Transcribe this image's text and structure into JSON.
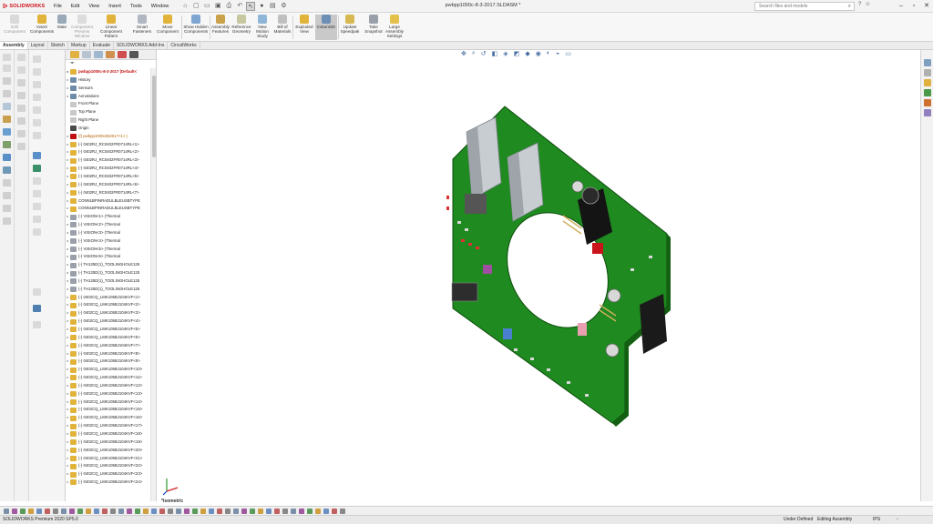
{
  "app": {
    "brand": "SOLIDWORKS",
    "menus": [
      "File",
      "Edit",
      "View",
      "Insert",
      "Tools",
      "Window"
    ],
    "document_title": "pwbpp1000c-8-3-2017.SLDASM *",
    "search_placeholder": "Search files and models"
  },
  "ribbon": {
    "buttons": [
      {
        "label": "Edit Component",
        "disabled": true
      },
      {
        "label": "Insert Components",
        "disabled": false
      },
      {
        "label": "Mate",
        "disabled": false
      },
      {
        "label": "Component Preview Window",
        "disabled": true
      },
      {
        "label": "Linear Component Pattern",
        "disabled": false
      },
      {
        "label": "Smart Fasteners",
        "disabled": false
      },
      {
        "label": "Move Component",
        "disabled": false
      },
      {
        "label": "Show Hidden Components",
        "disabled": false
      },
      {
        "label": "Assembly Features",
        "disabled": false
      },
      {
        "label": "Reference Geometry",
        "disabled": false
      },
      {
        "label": "New Motion Study",
        "disabled": false
      },
      {
        "label": "Bill of Materials",
        "disabled": false
      },
      {
        "label": "Exploded View",
        "disabled": false
      },
      {
        "label": "Instant3D",
        "disabled": false,
        "active": true
      },
      {
        "label": "Update Speedpak",
        "disabled": false
      },
      {
        "label": "Take Snapshot",
        "disabled": false
      },
      {
        "label": "Large Assembly Settings",
        "disabled": false
      }
    ]
  },
  "tabs": [
    "Assembly",
    "Layout",
    "Sketch",
    "Markup",
    "Evaluate",
    "SOLIDWORKS Add-Ins",
    "CircuitWorks"
  ],
  "tree": {
    "root": "pwbpp1000c-8-3-2017 (Default<",
    "items": [
      {
        "label": "History",
        "kind": "folder"
      },
      {
        "label": "Sensors",
        "kind": "folder"
      },
      {
        "label": "Annotations",
        "kind": "folder"
      },
      {
        "label": "Front Plane",
        "kind": "plane"
      },
      {
        "label": "Top Plane",
        "kind": "plane"
      },
      {
        "label": "Right Plane",
        "kind": "plane"
      },
      {
        "label": "Origin",
        "kind": "origin"
      },
      {
        "label": "(f) pwbpp1000c832017<1> (",
        "kind": "warn"
      },
      {
        "label": "(-) 0402RJ_RC0402FR0714RL<1>",
        "kind": "part"
      },
      {
        "label": "(-) 0402RJ_RC0402FR0714RL<2>",
        "kind": "part"
      },
      {
        "label": "(-) 0402RJ_RC0402FR0714RL<3>",
        "kind": "part"
      },
      {
        "label": "(-) 0402RJ_RC0402FR0714RL<4>",
        "kind": "part"
      },
      {
        "label": "(-) 0402RJ_RC0402FR0714RL<5>",
        "kind": "part"
      },
      {
        "label": "(-) 0402RJ_RC0402FR0714RL<6>",
        "kind": "part"
      },
      {
        "label": "(-) 0402RJ_RC0402FR0714RL<7>",
        "kind": "part"
      },
      {
        "label": "CONN1BPINRADULBLEUSBTYPE",
        "kind": "part"
      },
      {
        "label": "CONN1BPINRADULBLEUSBTYPE",
        "kind": "part"
      },
      {
        "label": "(-) VISION<1> (Thermal",
        "kind": "vision"
      },
      {
        "label": "(-) VISION<2> (Thermal",
        "kind": "vision"
      },
      {
        "label": "(-) VISION<3> (Thermal",
        "kind": "vision"
      },
      {
        "label": "(-) VISION<4> (Thermal",
        "kind": "vision"
      },
      {
        "label": "(-) VISION<5> (Thermal",
        "kind": "vision"
      },
      {
        "label": "(-) VISION<6> (Thermal",
        "kind": "vision"
      },
      {
        "label": "(-) TH125D(1)_TOOLINGHOLE125",
        "kind": "vision"
      },
      {
        "label": "(-) TH125D(1)_TOOLINGHOLE125",
        "kind": "vision"
      },
      {
        "label": "(-) TH125D(1)_TOOLINGHOLE125",
        "kind": "vision"
      },
      {
        "label": "(-) TH125D(1)_TOOLINGHOLE125",
        "kind": "vision"
      },
      {
        "label": "(-) 0402CQ_LMK105BJ104KVF<1>",
        "kind": "part"
      },
      {
        "label": "(-) 0402CQ_LMK105BJ104KVF<2>",
        "kind": "part"
      },
      {
        "label": "(-) 0402CQ_LMK105BJ104KVF<3>",
        "kind": "part"
      },
      {
        "label": "(-) 0402CQ_LMK105BJ104KVF<4>",
        "kind": "part"
      },
      {
        "label": "(-) 0402CQ_LMK105BJ104KVF<5>",
        "kind": "part"
      },
      {
        "label": "(-) 0402CQ_LMK105BJ104KVF<6>",
        "kind": "part"
      },
      {
        "label": "(-) 0402CQ_LMK105BJ104KVF<7>",
        "kind": "part"
      },
      {
        "label": "(-) 0402CQ_LMK105BJ104KVF<8>",
        "kind": "part"
      },
      {
        "label": "(-) 0402CQ_LMK105BJ104KVF<9>",
        "kind": "part"
      },
      {
        "label": "(-) 0402CQ_LMK105BJ104KVF<10>",
        "kind": "part"
      },
      {
        "label": "(-) 0402CQ_LMK105BJ104KVF<11>",
        "kind": "part"
      },
      {
        "label": "(-) 0402CQ_LMK105BJ104KVF<12>",
        "kind": "part"
      },
      {
        "label": "(-) 0402CQ_LMK105BJ104KVF<13>",
        "kind": "part"
      },
      {
        "label": "(-) 0402CQ_LMK105BJ104KVF<14>",
        "kind": "part"
      },
      {
        "label": "(-) 0402CQ_LMK105BJ104KVF<15>",
        "kind": "part"
      },
      {
        "label": "(-) 0402CQ_LMK105BJ104KVF<16>",
        "kind": "part"
      },
      {
        "label": "(-) 0402CQ_LMK105BJ104KVF<17>",
        "kind": "part"
      },
      {
        "label": "(-) 0402CQ_LMK105BJ104KVF<18>",
        "kind": "part"
      },
      {
        "label": "(-) 0402CQ_LMK105BJ104KVF<19>",
        "kind": "part"
      },
      {
        "label": "(-) 0402CQ_LMK105BJ104KVF<20>",
        "kind": "part"
      },
      {
        "label": "(-) 0402CQ_LMK105BJ104KVF<21>",
        "kind": "part"
      },
      {
        "label": "(-) 0402CQ_LMK105BJ104KVF<22>",
        "kind": "part"
      },
      {
        "label": "(-) 0402CQ_LMK105BJ104KVF<23>",
        "kind": "part"
      },
      {
        "label": "(-) 0402CQ_LMK105BJ104KVF<24>",
        "kind": "part"
      }
    ]
  },
  "viewport": {
    "view_name": "*Isometric"
  },
  "status": {
    "product": "SOLIDWORKS Premium 2020 SP5.0",
    "state": "Under Defined",
    "mode": "Editing Assembly",
    "units": "IPS"
  },
  "colors": {
    "pcb": "#1f8a1f",
    "pcb_dark": "#136013",
    "accent_red": "#d0121b",
    "ui_bg": "#f3f3f3"
  }
}
